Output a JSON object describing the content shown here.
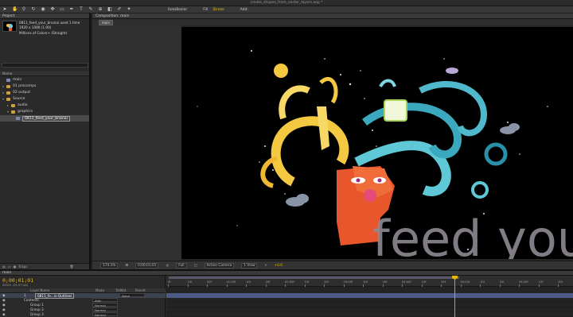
{
  "window": {
    "title": "create_shapes_from_vector_layers.aep *"
  },
  "toolbar": {
    "rotobezier_label": "RotoBezier",
    "fill_label": "Fill",
    "stroke_label": "Stroke",
    "add_label": "Add:"
  },
  "project": {
    "tab_label": "Project",
    "selected_item": "0811_feed_your_brainai",
    "item_used": "used 1 time",
    "item_size": "1920 x 1080 (1.00)",
    "item_colors": "Millions of Colors+ (Straight)",
    "column_name": "Name",
    "tree": [
      {
        "label": "main",
        "type": "comp",
        "indent": 0
      },
      {
        "label": "01 precomps",
        "type": "folder",
        "indent": 0,
        "tri": "▸"
      },
      {
        "label": "02 output",
        "type": "folder",
        "indent": 0,
        "tri": "▸"
      },
      {
        "label": "Source",
        "type": "folder",
        "indent": 0,
        "tri": "▾"
      },
      {
        "label": "audio",
        "type": "folder",
        "indent": 1,
        "tri": "▸"
      },
      {
        "label": "graphics",
        "type": "folder",
        "indent": 1,
        "tri": "▾"
      },
      {
        "label": "0811_feed_your_brainai",
        "type": "item",
        "indent": 2,
        "selected": true
      }
    ],
    "bpc": "8 bpc"
  },
  "composition": {
    "tab_label": "Composition: main",
    "chip_label": "main",
    "viewer": {
      "overlay_text": "feed your brai"
    },
    "controls": {
      "zoom": "174.1%",
      "timecode": "0;00;01;01",
      "resolution": "Full",
      "camera": "Active Camera",
      "views": "1 View",
      "exposure": "+0.0"
    }
  },
  "timeline": {
    "tab_label": "main",
    "timecode": "0;00;01;01",
    "fps": "00031 (29.97 fps)",
    "col_layer_name": "Layer Name",
    "col_mode": "Mode",
    "col_trkmat": "TrkMat",
    "col_parent": "Parent",
    "ruler_labels": [
      "0f",
      "10f",
      "20f",
      "01:00f",
      "10f",
      "20f",
      "02:00f",
      "10f",
      "20f",
      "03:00f",
      "10f",
      "20f",
      "04:00f",
      "10f",
      "20f",
      "05:00f",
      "10f",
      "20f",
      "06:00f",
      "10f",
      "20f"
    ],
    "layers": [
      {
        "num": "1",
        "name": "0811_fe...in Outlines",
        "mode": "None",
        "main": true
      },
      {
        "num": "",
        "name": "Contents",
        "mode": "Add:"
      },
      {
        "num": "",
        "name": "Group 1",
        "mode": "Normal"
      },
      {
        "num": "",
        "name": "Group 3",
        "mode": "Normal"
      },
      {
        "num": "",
        "name": "Group 3",
        "mode": "Normal"
      }
    ]
  }
}
